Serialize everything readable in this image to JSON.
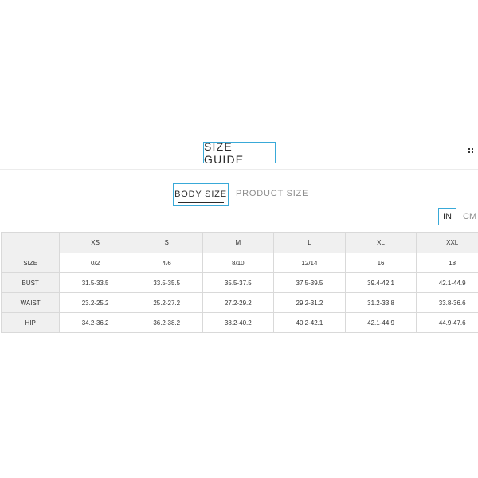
{
  "header": {
    "title": "SIZE GUIDE",
    "menu_icon": "grip-dots-icon"
  },
  "tabs": [
    {
      "label": "BODY SIZE",
      "active": true
    },
    {
      "label": "PRODUCT SIZE",
      "active": false
    }
  ],
  "units": {
    "options": [
      "IN",
      "CM"
    ],
    "selected": "IN"
  },
  "table": {
    "columns": [
      "",
      "XS",
      "S",
      "M",
      "L",
      "XL",
      "XXL"
    ],
    "rows": [
      {
        "label": "SIZE",
        "values": [
          "0/2",
          "4/6",
          "8/10",
          "12/14",
          "16",
          "18"
        ]
      },
      {
        "label": "BUST",
        "values": [
          "31.5-33.5",
          "33.5-35.5",
          "35.5-37.5",
          "37.5-39.5",
          "39.4-42.1",
          "42.1-44.9"
        ]
      },
      {
        "label": "WAIST",
        "values": [
          "23.2-25.2",
          "25.2-27.2",
          "27.2-29.2",
          "29.2-31.2",
          "31.2-33.8",
          "33.8-36.6"
        ]
      },
      {
        "label": "HIP",
        "values": [
          "34.2-36.2",
          "36.2-38.2",
          "38.2-40.2",
          "40.2-42.1",
          "42.1-44.9",
          "44.9-47.6"
        ]
      }
    ]
  },
  "colors": {
    "accent_border": "#39a9d8",
    "header_cell_bg": "#f0f0f0",
    "inactive_text": "#8c8c8c"
  }
}
